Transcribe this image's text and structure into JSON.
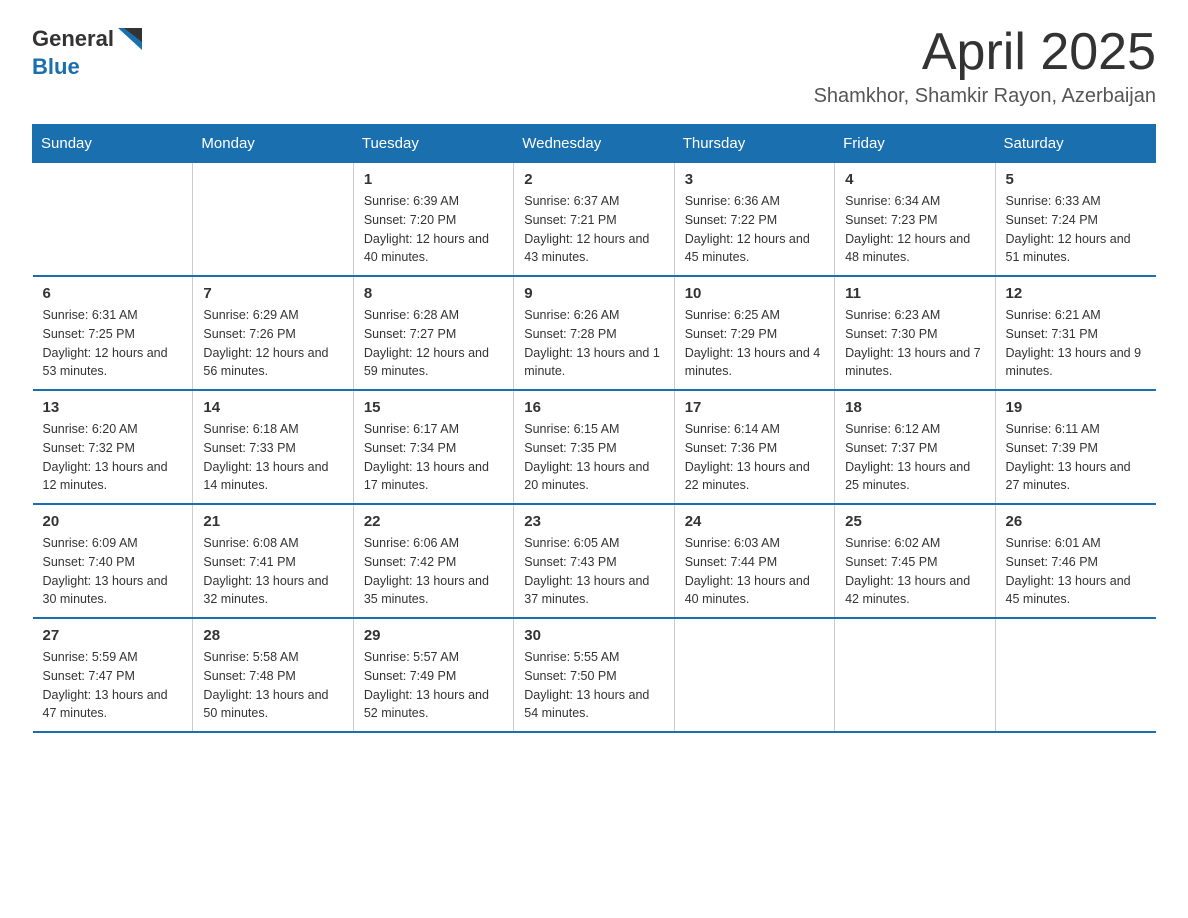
{
  "logo": {
    "text_general": "General",
    "text_blue": "Blue"
  },
  "title": "April 2025",
  "subtitle": "Shamkhor, Shamkir Rayon, Azerbaijan",
  "days_of_week": [
    "Sunday",
    "Monday",
    "Tuesday",
    "Wednesday",
    "Thursday",
    "Friday",
    "Saturday"
  ],
  "weeks": [
    [
      {
        "day": "",
        "info": ""
      },
      {
        "day": "",
        "info": ""
      },
      {
        "day": "1",
        "info": "Sunrise: 6:39 AM\nSunset: 7:20 PM\nDaylight: 12 hours\nand 40 minutes."
      },
      {
        "day": "2",
        "info": "Sunrise: 6:37 AM\nSunset: 7:21 PM\nDaylight: 12 hours\nand 43 minutes."
      },
      {
        "day": "3",
        "info": "Sunrise: 6:36 AM\nSunset: 7:22 PM\nDaylight: 12 hours\nand 45 minutes."
      },
      {
        "day": "4",
        "info": "Sunrise: 6:34 AM\nSunset: 7:23 PM\nDaylight: 12 hours\nand 48 minutes."
      },
      {
        "day": "5",
        "info": "Sunrise: 6:33 AM\nSunset: 7:24 PM\nDaylight: 12 hours\nand 51 minutes."
      }
    ],
    [
      {
        "day": "6",
        "info": "Sunrise: 6:31 AM\nSunset: 7:25 PM\nDaylight: 12 hours\nand 53 minutes."
      },
      {
        "day": "7",
        "info": "Sunrise: 6:29 AM\nSunset: 7:26 PM\nDaylight: 12 hours\nand 56 minutes."
      },
      {
        "day": "8",
        "info": "Sunrise: 6:28 AM\nSunset: 7:27 PM\nDaylight: 12 hours\nand 59 minutes."
      },
      {
        "day": "9",
        "info": "Sunrise: 6:26 AM\nSunset: 7:28 PM\nDaylight: 13 hours\nand 1 minute."
      },
      {
        "day": "10",
        "info": "Sunrise: 6:25 AM\nSunset: 7:29 PM\nDaylight: 13 hours\nand 4 minutes."
      },
      {
        "day": "11",
        "info": "Sunrise: 6:23 AM\nSunset: 7:30 PM\nDaylight: 13 hours\nand 7 minutes."
      },
      {
        "day": "12",
        "info": "Sunrise: 6:21 AM\nSunset: 7:31 PM\nDaylight: 13 hours\nand 9 minutes."
      }
    ],
    [
      {
        "day": "13",
        "info": "Sunrise: 6:20 AM\nSunset: 7:32 PM\nDaylight: 13 hours\nand 12 minutes."
      },
      {
        "day": "14",
        "info": "Sunrise: 6:18 AM\nSunset: 7:33 PM\nDaylight: 13 hours\nand 14 minutes."
      },
      {
        "day": "15",
        "info": "Sunrise: 6:17 AM\nSunset: 7:34 PM\nDaylight: 13 hours\nand 17 minutes."
      },
      {
        "day": "16",
        "info": "Sunrise: 6:15 AM\nSunset: 7:35 PM\nDaylight: 13 hours\nand 20 minutes."
      },
      {
        "day": "17",
        "info": "Sunrise: 6:14 AM\nSunset: 7:36 PM\nDaylight: 13 hours\nand 22 minutes."
      },
      {
        "day": "18",
        "info": "Sunrise: 6:12 AM\nSunset: 7:37 PM\nDaylight: 13 hours\nand 25 minutes."
      },
      {
        "day": "19",
        "info": "Sunrise: 6:11 AM\nSunset: 7:39 PM\nDaylight: 13 hours\nand 27 minutes."
      }
    ],
    [
      {
        "day": "20",
        "info": "Sunrise: 6:09 AM\nSunset: 7:40 PM\nDaylight: 13 hours\nand 30 minutes."
      },
      {
        "day": "21",
        "info": "Sunrise: 6:08 AM\nSunset: 7:41 PM\nDaylight: 13 hours\nand 32 minutes."
      },
      {
        "day": "22",
        "info": "Sunrise: 6:06 AM\nSunset: 7:42 PM\nDaylight: 13 hours\nand 35 minutes."
      },
      {
        "day": "23",
        "info": "Sunrise: 6:05 AM\nSunset: 7:43 PM\nDaylight: 13 hours\nand 37 minutes."
      },
      {
        "day": "24",
        "info": "Sunrise: 6:03 AM\nSunset: 7:44 PM\nDaylight: 13 hours\nand 40 minutes."
      },
      {
        "day": "25",
        "info": "Sunrise: 6:02 AM\nSunset: 7:45 PM\nDaylight: 13 hours\nand 42 minutes."
      },
      {
        "day": "26",
        "info": "Sunrise: 6:01 AM\nSunset: 7:46 PM\nDaylight: 13 hours\nand 45 minutes."
      }
    ],
    [
      {
        "day": "27",
        "info": "Sunrise: 5:59 AM\nSunset: 7:47 PM\nDaylight: 13 hours\nand 47 minutes."
      },
      {
        "day": "28",
        "info": "Sunrise: 5:58 AM\nSunset: 7:48 PM\nDaylight: 13 hours\nand 50 minutes."
      },
      {
        "day": "29",
        "info": "Sunrise: 5:57 AM\nSunset: 7:49 PM\nDaylight: 13 hours\nand 52 minutes."
      },
      {
        "day": "30",
        "info": "Sunrise: 5:55 AM\nSunset: 7:50 PM\nDaylight: 13 hours\nand 54 minutes."
      },
      {
        "day": "",
        "info": ""
      },
      {
        "day": "",
        "info": ""
      },
      {
        "day": "",
        "info": ""
      }
    ]
  ]
}
